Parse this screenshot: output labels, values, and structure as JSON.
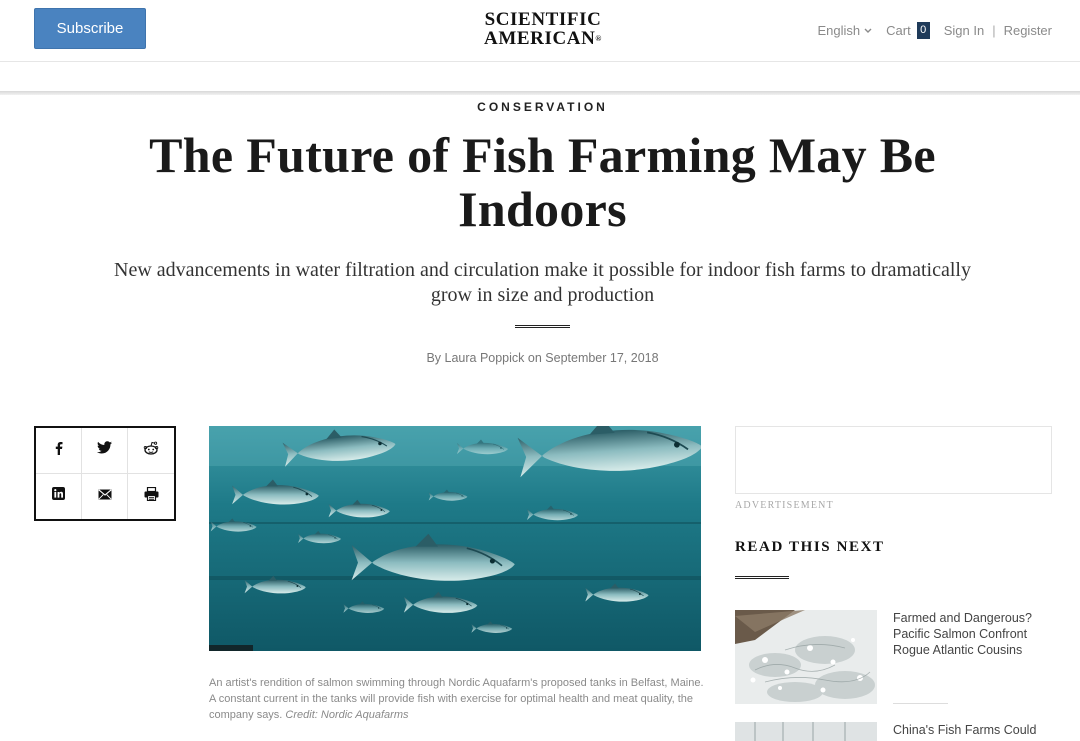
{
  "header": {
    "subscribe_label": "Subscribe",
    "logo_line1": "SCIENTIFIC",
    "logo_line2": "AMERICAN",
    "logo_mark": "®",
    "language": "English",
    "cart_label": "Cart",
    "cart_count": "0",
    "signin_label": "Sign In",
    "separator": "|",
    "register_label": "Register"
  },
  "article": {
    "kicker": "CONSERVATION",
    "headline": "The Future of Fish Farming May Be Indoors",
    "dek": "New advancements in water filtration and circulation make it possible for indoor fish farms to dramatically grow in size and production",
    "byline_prefix": "By ",
    "author": "Laura Poppick",
    "byline_mid": " on ",
    "date": "September 17, 2018",
    "caption_text": "An artist's rendition of salmon swimming through Nordic Aquafarm's proposed tanks in Belfast, Maine. A constant current in the tanks will provide fish with exercise for optimal health and meat quality, the company says. ",
    "caption_credit": "Credit: Nordic Aquafarms"
  },
  "share": {
    "icons": [
      "facebook-icon",
      "twitter-icon",
      "reddit-icon",
      "linkedin-icon",
      "email-icon",
      "print-icon"
    ]
  },
  "sidebar": {
    "ad_label": "ADVERTISEMENT",
    "read_next_title": "READ THIS NEXT",
    "items": [
      {
        "headline": "Farmed and Dangerous? Pacific Salmon Confront Rogue Atlantic Cousins"
      },
      {
        "headline": "China's Fish Farms Could"
      }
    ]
  },
  "colors": {
    "subscribe_bg": "#4a83c0",
    "cart_badge": "#1f3b5a",
    "water": "#1c7282"
  }
}
